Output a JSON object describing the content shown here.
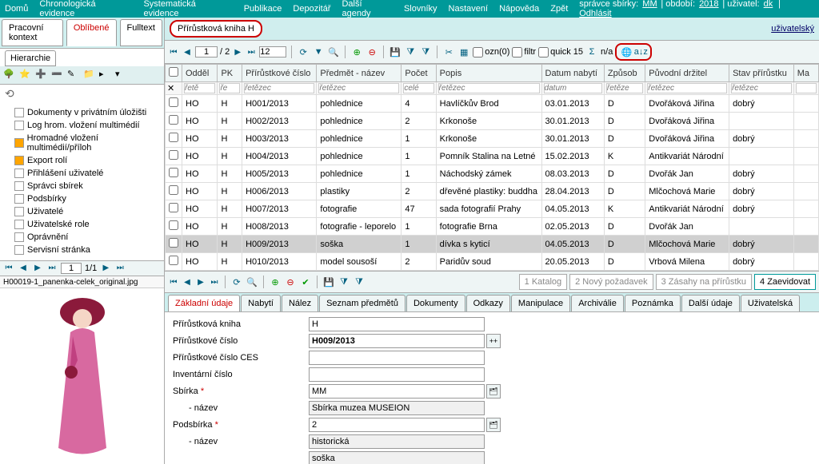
{
  "menu": {
    "items": [
      "Domů",
      "Chronologická evidence",
      "Systematická evidence",
      "Publikace",
      "Depozitář",
      "Další agendy",
      "Slovníky",
      "Nastavení",
      "Nápověda",
      "Zpět"
    ]
  },
  "user_bar": {
    "prefix": "správce sbírky: ",
    "coll": "MM",
    "period_lbl": " | období: ",
    "period": "2018",
    "user_lbl": " | uživatel: ",
    "user": "dk",
    "logout": " | Odhlásit"
  },
  "left": {
    "tabs": [
      "Pracovní kontext",
      "Oblíbené",
      "Fulltext"
    ],
    "sub": "Hierarchie",
    "tree": [
      {
        "t": "Dokumenty v privátním úložišti",
        "o": false
      },
      {
        "t": "Log hrom. vložení multimédií",
        "o": false
      },
      {
        "t": "Hromadné vložení multimédií/příloh",
        "o": true
      },
      {
        "t": "Export rolí",
        "o": true
      },
      {
        "t": "Přihlášení uživatelé",
        "o": false
      },
      {
        "t": "Správci sbírek",
        "o": false
      },
      {
        "t": "Podsbírky",
        "o": false
      },
      {
        "t": "Uživatelé",
        "o": false
      },
      {
        "t": "Uživatelské role",
        "o": false
      },
      {
        "t": "Oprávnění",
        "o": false
      },
      {
        "t": "Servisní stránka",
        "o": false
      }
    ],
    "pager": {
      "page": "1",
      "total": "1/1"
    },
    "thumb": "H00019-1_panenka-celek_original.jpg"
  },
  "context": {
    "title": "Přírůstková kniha H",
    "user_link": "uživatelský"
  },
  "grid_tb": {
    "page": "1",
    "pages": "/ 2",
    "page_size": "12",
    "ozn": "ozn(0)",
    "filtr": "filtr",
    "quick": "quick",
    "num": "15",
    "na": "n/a"
  },
  "cols": [
    "",
    "Odděl",
    "PK",
    "Přírůstkové číslo",
    "Předmět - název",
    "Počet",
    "Popis",
    "Datum nabytí",
    "Způsob",
    "Původní držitel",
    "Stav přírůstku",
    "Ma"
  ],
  "filters": [
    "",
    "řetě",
    "ře",
    "řetězec",
    "řetězec",
    "celé",
    "řetězec",
    "datum",
    "řetěze",
    "řetězec",
    "řetězec",
    ""
  ],
  "rows": [
    [
      "HO",
      "H",
      "H001/2013",
      "pohlednice",
      "4",
      "Havlíčkův Brod",
      "03.01.2013",
      "D",
      "Dvořáková Jiřina",
      "dobrý"
    ],
    [
      "HO",
      "H",
      "H002/2013",
      "pohlednice",
      "2",
      "Krkonoše",
      "30.01.2013",
      "D",
      "Dvořáková Jiřina",
      ""
    ],
    [
      "HO",
      "H",
      "H003/2013",
      "pohlednice",
      "1",
      "Krkonoše",
      "30.01.2013",
      "D",
      "Dvořáková Jiřina",
      "dobrý"
    ],
    [
      "HO",
      "H",
      "H004/2013",
      "pohlednice",
      "1",
      "Pomník Stalina na Letné",
      "15.02.2013",
      "K",
      "Antikvariát Národní",
      ""
    ],
    [
      "HO",
      "H",
      "H005/2013",
      "pohlednice",
      "1",
      "Náchodský zámek",
      "08.03.2013",
      "D",
      "Dvořák Jan",
      "dobrý"
    ],
    [
      "HO",
      "H",
      "H006/2013",
      "plastiky",
      "2",
      "dřevěné plastiky: buddha",
      "28.04.2013",
      "D",
      "Mlčochová Marie",
      "dobrý"
    ],
    [
      "HO",
      "H",
      "H007/2013",
      "fotografie",
      "47",
      "sada fotografií Prahy",
      "04.05.2013",
      "K",
      "Antikvariát Národní",
      "dobrý"
    ],
    [
      "HO",
      "H",
      "H008/2013",
      "fotografie - leporelo",
      "1",
      "fotografie Brna",
      "02.05.2013",
      "D",
      "Dvořák Jan",
      ""
    ],
    [
      "HO",
      "H",
      "H009/2013",
      "soška",
      "1",
      "dívka s kyticí",
      "04.05.2013",
      "D",
      "Mlčochová Marie",
      "dobrý"
    ],
    [
      "HO",
      "H",
      "H010/2013",
      "model sousoší",
      "2",
      "Paridův soud",
      "20.05.2013",
      "D",
      "Vrbová Milena",
      "dobrý"
    ]
  ],
  "selected_row": 8,
  "detail_actions": [
    "1 Katalog",
    "2 Nový požadavek",
    "3 Zásahy na přírůstku",
    "4 Zaevidovat"
  ],
  "detail_tabs": [
    "Základní údaje",
    "Nabytí",
    "Nález",
    "Seznam předmětů",
    "Dokumenty",
    "Odkazy",
    "Manipulace",
    "Archiválie",
    "Poznámka",
    "Další údaje",
    "Uživatelská"
  ],
  "form": {
    "f1": {
      "l": "Přírůstková kniha",
      "v": "H"
    },
    "f2": {
      "l": "Přírůstkové číslo",
      "v": "H009/2013"
    },
    "f3": {
      "l": "Přírůstkové číslo CES",
      "v": ""
    },
    "f4": {
      "l": "Inventární číslo",
      "v": ""
    },
    "f5": {
      "l": "Sbírka",
      "v": "MM",
      "req": true
    },
    "f5n": {
      "l": "- název",
      "v": "Sbírka muzea MUSEION"
    },
    "f6": {
      "l": "Podsbírka",
      "v": "2",
      "req": true
    },
    "f6n": {
      "l": "- název",
      "v": "historická"
    },
    "f7": {
      "v": "soška"
    }
  }
}
